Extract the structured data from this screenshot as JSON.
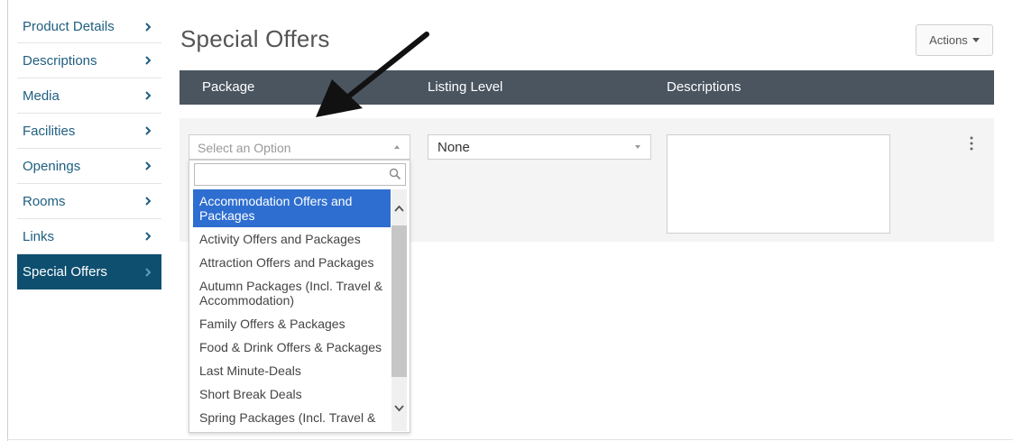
{
  "sidebar": {
    "items": [
      {
        "label": "Product Details",
        "active": false
      },
      {
        "label": "Descriptions",
        "active": false
      },
      {
        "label": "Media",
        "active": false
      },
      {
        "label": "Facilities",
        "active": false
      },
      {
        "label": "Openings",
        "active": false
      },
      {
        "label": "Rooms",
        "active": false
      },
      {
        "label": "Links",
        "active": false
      },
      {
        "label": "Special Offers",
        "active": true
      }
    ],
    "chevron_icon": "chevron-right-icon",
    "link_color": "#1f5f80",
    "active_bg": "#0e4f70"
  },
  "page": {
    "title": "Special Offers",
    "actions_label": "Actions"
  },
  "table": {
    "headers": [
      "Package",
      "Listing Level",
      "Descriptions"
    ],
    "header_bg": "#4a5560"
  },
  "package_select": {
    "placeholder": "Select an Option",
    "search_value": "",
    "options": [
      "Accommodation Offers and Packages",
      "Activity Offers and Packages",
      "Attraction Offers and Packages",
      "Autumn Packages (Incl. Travel & Accommodation)",
      "Family Offers & Packages",
      "Food & Drink Offers & Packages",
      "Last Minute-Deals",
      "Short Break Deals",
      "Spring Packages (Incl. Travel &"
    ],
    "highlighted_index": 0,
    "highlight_color": "#2e6ed0"
  },
  "listing_level": {
    "value": "None"
  },
  "descriptions": {
    "value": ""
  },
  "annotation": {
    "icon": "arrow-annotation-icon"
  }
}
